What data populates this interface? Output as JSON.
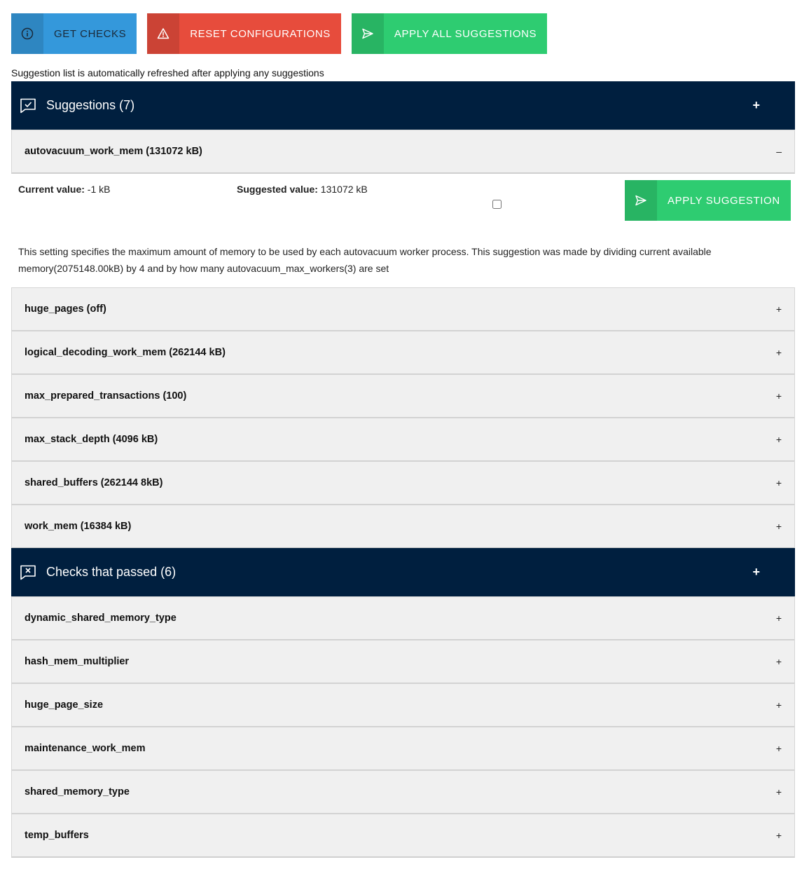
{
  "toolbar": {
    "get_checks": "GET CHECKS",
    "reset_configurations": "RESET CONFIGURATIONS",
    "apply_all": "APPLY ALL SUGGESTIONS"
  },
  "note": "Suggestion list is automatically refreshed after applying any suggestions",
  "suggestions": {
    "title": "Suggestions (7)",
    "toggle": "+",
    "expanded": {
      "title": "autovacuum_work_mem (131072 kB)",
      "toggle": "–",
      "current_label": "Current value:",
      "current_value": " -1 kB",
      "suggested_label": "Suggested value:",
      "suggested_value": " 131072 kB",
      "apply_label": "APPLY SUGGESTION",
      "description": "This setting specifies the maximum amount of memory to be used by each autovacuum worker process. This suggestion was made by dividing current available memory(2075148.00kB) by 4 and by how many autovacuum_max_workers(3) are set"
    },
    "items": [
      {
        "title": "huge_pages (off)",
        "toggle": "+"
      },
      {
        "title": "logical_decoding_work_mem (262144 kB)",
        "toggle": "+"
      },
      {
        "title": "max_prepared_transactions (100)",
        "toggle": "+"
      },
      {
        "title": "max_stack_depth (4096 kB)",
        "toggle": "+"
      },
      {
        "title": "shared_buffers (262144 8kB)",
        "toggle": "+"
      },
      {
        "title": "work_mem (16384 kB)",
        "toggle": "+"
      }
    ]
  },
  "passed": {
    "title": "Checks that passed (6)",
    "toggle": "+",
    "items": [
      {
        "title": "dynamic_shared_memory_type",
        "toggle": "+"
      },
      {
        "title": "hash_mem_multiplier",
        "toggle": "+"
      },
      {
        "title": "huge_page_size",
        "toggle": "+"
      },
      {
        "title": "maintenance_work_mem",
        "toggle": "+"
      },
      {
        "title": "shared_memory_type",
        "toggle": "+"
      },
      {
        "title": "temp_buffers",
        "toggle": "+"
      }
    ]
  },
  "colors": {
    "blue": "#3498db",
    "red": "#e74c3c",
    "green": "#2ecc71",
    "header": "#001f3f",
    "row": "#f0f0f0"
  },
  "icons": {
    "get_checks": "info-icon",
    "reset": "warning-icon",
    "apply": "send-icon",
    "suggestions": "chat-check-icon",
    "passed": "chat-x-icon"
  }
}
